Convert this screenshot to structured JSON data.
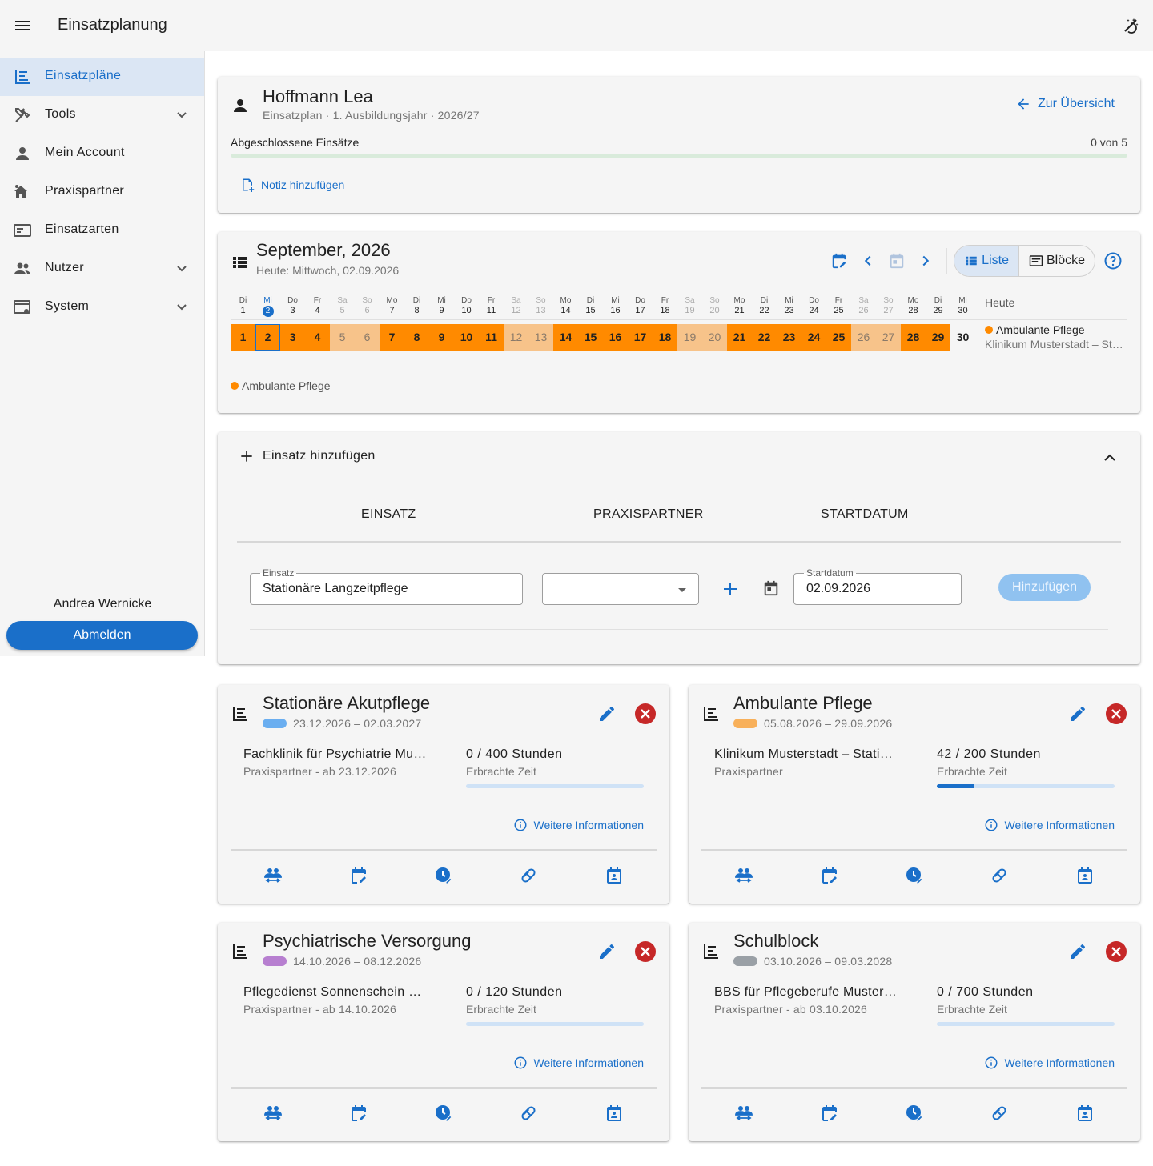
{
  "app": {
    "title": "Einsatzplanung"
  },
  "colors": {
    "accent": "#1a6fc9",
    "assignment": "#ff8a00",
    "danger": "#c62828"
  },
  "sidebar": {
    "items": [
      {
        "label": "Einsatzpläne",
        "icon": "plan-timeline-icon",
        "active": true
      },
      {
        "label": "Tools",
        "icon": "tools-icon",
        "expandable": true
      },
      {
        "label": "Mein Account",
        "icon": "person-icon"
      },
      {
        "label": "Praxispartner",
        "icon": "partner-home-icon"
      },
      {
        "label": "Einsatzarten",
        "icon": "card-icon"
      },
      {
        "label": "Nutzer",
        "icon": "users-icon",
        "expandable": true
      },
      {
        "label": "System",
        "icon": "system-settings-icon",
        "expandable": true
      }
    ],
    "user_name": "Andrea Wernicke",
    "logout_label": "Abmelden"
  },
  "header_card": {
    "name": "Hoffmann Lea",
    "subtitle": "Einsatzplan · 1. Ausbildungsjahr · 2026/27",
    "back_label": "Zur Übersicht",
    "progress_label": "Abgeschlossene Einsätze",
    "progress_value": "0 von 5",
    "progress_fraction": 0,
    "note_label": "Notiz hinzufügen"
  },
  "calendar": {
    "month": "September, 2026",
    "today": "Heute: Mittwoch, 02.09.2026",
    "view_list": "Liste",
    "view_blocks": "Blöcke",
    "heute_label": "Heute",
    "heute_assignment": "Ambulante Pflege",
    "heute_partner": "Klinikum Musterstadt – Stationäre Pflege",
    "legend": "Ambulante Pflege",
    "current_day": 2,
    "days": [
      {
        "wd": "Di",
        "d": "1",
        "we": false,
        "a": true
      },
      {
        "wd": "Mi",
        "d": "2",
        "we": false,
        "a": true
      },
      {
        "wd": "Do",
        "d": "3",
        "we": false,
        "a": true
      },
      {
        "wd": "Fr",
        "d": "4",
        "we": false,
        "a": true
      },
      {
        "wd": "Sa",
        "d": "5",
        "we": true,
        "a": true
      },
      {
        "wd": "So",
        "d": "6",
        "we": true,
        "a": true
      },
      {
        "wd": "Mo",
        "d": "7",
        "we": false,
        "a": true
      },
      {
        "wd": "Di",
        "d": "8",
        "we": false,
        "a": true
      },
      {
        "wd": "Mi",
        "d": "9",
        "we": false,
        "a": true
      },
      {
        "wd": "Do",
        "d": "10",
        "we": false,
        "a": true
      },
      {
        "wd": "Fr",
        "d": "11",
        "we": false,
        "a": true
      },
      {
        "wd": "Sa",
        "d": "12",
        "we": true,
        "a": true
      },
      {
        "wd": "So",
        "d": "13",
        "we": true,
        "a": true
      },
      {
        "wd": "Mo",
        "d": "14",
        "we": false,
        "a": true
      },
      {
        "wd": "Di",
        "d": "15",
        "we": false,
        "a": true
      },
      {
        "wd": "Mi",
        "d": "16",
        "we": false,
        "a": true
      },
      {
        "wd": "Do",
        "d": "17",
        "we": false,
        "a": true
      },
      {
        "wd": "Fr",
        "d": "18",
        "we": false,
        "a": true
      },
      {
        "wd": "Sa",
        "d": "19",
        "we": true,
        "a": true
      },
      {
        "wd": "So",
        "d": "20",
        "we": true,
        "a": true
      },
      {
        "wd": "Mo",
        "d": "21",
        "we": false,
        "a": true
      },
      {
        "wd": "Di",
        "d": "22",
        "we": false,
        "a": true
      },
      {
        "wd": "Mi",
        "d": "23",
        "we": false,
        "a": true
      },
      {
        "wd": "Do",
        "d": "24",
        "we": false,
        "a": true
      },
      {
        "wd": "Fr",
        "d": "25",
        "we": false,
        "a": true
      },
      {
        "wd": "Sa",
        "d": "26",
        "we": true,
        "a": true
      },
      {
        "wd": "So",
        "d": "27",
        "we": true,
        "a": true
      },
      {
        "wd": "Mo",
        "d": "28",
        "we": false,
        "a": true
      },
      {
        "wd": "Di",
        "d": "29",
        "we": false,
        "a": true
      },
      {
        "wd": "Mi",
        "d": "30",
        "we": false,
        "a": false
      }
    ]
  },
  "add_form": {
    "title": "Einsatz hinzufügen",
    "col_einsatz": "EINSATZ",
    "col_partner": "PRAXISPARTNER",
    "col_start": "STARTDATUM",
    "einsatz_label": "Einsatz",
    "einsatz_value": "Stationäre Langzeitpflege",
    "partner_value": "",
    "start_label": "Startdatum",
    "start_value": "02.09.2026",
    "submit_label": "Hinzufügen"
  },
  "assignments": [
    {
      "title": "Stationäre Akutpflege",
      "color": "#6aaef0",
      "range": "23.12.2026 – 02.03.2027",
      "partner": "Fachklinik für Psychiatrie Musterstadt",
      "partner_sub": "Praxispartner - ab 23.12.2026",
      "hours": "0 / 400 Stunden",
      "hours_sub": "Erbrachte Zeit",
      "fraction": 0,
      "info": "Weitere Informationen"
    },
    {
      "title": "Ambulante Pflege",
      "color": "#f8b05a",
      "range": "05.08.2026 – 29.09.2026",
      "partner": "Klinikum Musterstadt – Stationäre Pflege",
      "partner_sub": "Praxispartner",
      "hours": "42 / 200 Stunden",
      "hours_sub": "Erbrachte Zeit",
      "fraction": 0.21,
      "info": "Weitere Informationen"
    },
    {
      "title": "Psychiatrische Versorgung",
      "color": "#b77fd0",
      "range": "14.10.2026 – 08.12.2026",
      "partner": "Pflegedienst Sonnenschein GmbH",
      "partner_sub": "Praxispartner - ab 14.10.2026",
      "hours": "0 / 120 Stunden",
      "hours_sub": "Erbrachte Zeit",
      "fraction": 0,
      "info": "Weitere Informationen"
    },
    {
      "title": "Schulblock",
      "color": "#9aa0a6",
      "range": "03.10.2026 – 09.03.2028",
      "partner": "BBS für Pflegeberufe Musterstadt",
      "partner_sub": "Praxispartner - ab 03.10.2026",
      "hours": "0 / 700 Stunden",
      "hours_sub": "Erbrachte Zeit",
      "fraction": 0,
      "info": "Weitere Informationen"
    }
  ]
}
